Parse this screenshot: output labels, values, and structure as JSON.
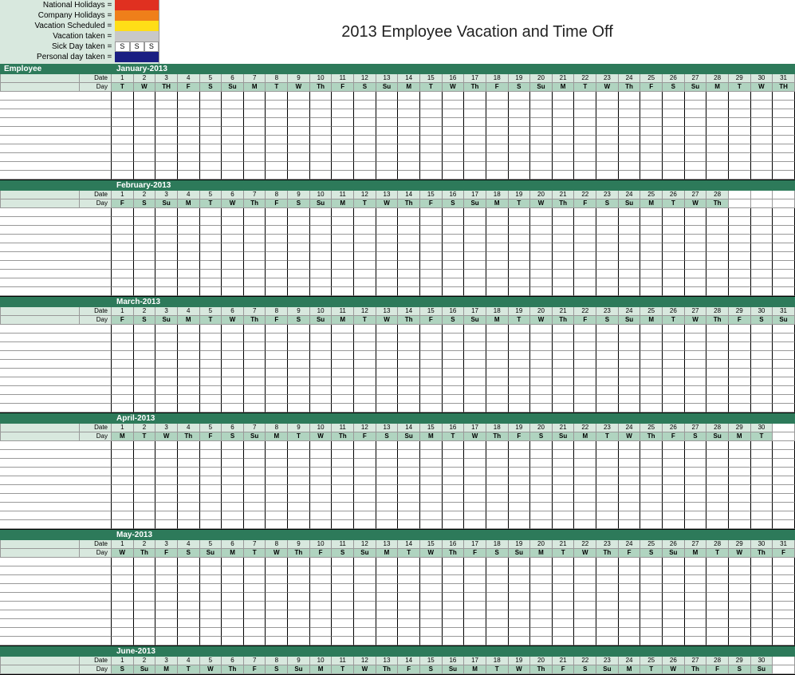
{
  "title": "2013 Employee Vacation and Time Off",
  "legend": {
    "national": "National Holidays =",
    "company": "Company Holidays =",
    "scheduled": "Vacation Scheduled =",
    "taken": "Vacation taken =",
    "sick": "Sick Day taken =",
    "personal": "Personal day taken =",
    "sick_marker": "S"
  },
  "employee_header": "Employee",
  "row_labels": {
    "date": "Date",
    "day": "Day"
  },
  "max_cols": 31,
  "emp_rows": 10,
  "months": [
    {
      "name": "January-2013",
      "days": 31,
      "dow": [
        "T",
        "W",
        "TH",
        "F",
        "S",
        "Su",
        "M",
        "T",
        "W",
        "Th",
        "F",
        "S",
        "Su",
        "M",
        "T",
        "W",
        "Th",
        "F",
        "S",
        "Su",
        "M",
        "T",
        "W",
        "Th",
        "F",
        "S",
        "Su",
        "M",
        "T",
        "W",
        "TH"
      ]
    },
    {
      "name": "February-2013",
      "days": 28,
      "dow": [
        "F",
        "S",
        "Su",
        "M",
        "T",
        "W",
        "Th",
        "F",
        "S",
        "Su",
        "M",
        "T",
        "W",
        "Th",
        "F",
        "S",
        "Su",
        "M",
        "T",
        "W",
        "Th",
        "F",
        "S",
        "Su",
        "M",
        "T",
        "W",
        "Th"
      ]
    },
    {
      "name": "March-2013",
      "days": 31,
      "dow": [
        "F",
        "S",
        "Su",
        "M",
        "T",
        "W",
        "Th",
        "F",
        "S",
        "Su",
        "M",
        "T",
        "W",
        "Th",
        "F",
        "S",
        "Su",
        "M",
        "T",
        "W",
        "Th",
        "F",
        "S",
        "Su",
        "M",
        "T",
        "W",
        "Th",
        "F",
        "S",
        "Su"
      ]
    },
    {
      "name": "April-2013",
      "days": 30,
      "dow": [
        "M",
        "T",
        "W",
        "Th",
        "F",
        "S",
        "Su",
        "M",
        "T",
        "W",
        "Th",
        "F",
        "S",
        "Su",
        "M",
        "T",
        "W",
        "Th",
        "F",
        "S",
        "Su",
        "M",
        "T",
        "W",
        "Th",
        "F",
        "S",
        "Su",
        "M",
        "T"
      ]
    },
    {
      "name": "May-2013",
      "days": 31,
      "dow": [
        "W",
        "Th",
        "F",
        "S",
        "Su",
        "M",
        "T",
        "W",
        "Th",
        "F",
        "S",
        "Su",
        "M",
        "T",
        "W",
        "Th",
        "F",
        "S",
        "Su",
        "M",
        "T",
        "W",
        "Th",
        "F",
        "S",
        "Su",
        "M",
        "T",
        "W",
        "Th",
        "F"
      ]
    },
    {
      "name": "June-2013",
      "days": 30,
      "dow": [
        "S",
        "Su",
        "M",
        "T",
        "W",
        "Th",
        "F",
        "S",
        "Su",
        "M",
        "T",
        "W",
        "Th",
        "F",
        "S",
        "Su",
        "M",
        "T",
        "W",
        "Th",
        "F",
        "S",
        "Su",
        "M",
        "T",
        "W",
        "Th",
        "F",
        "S",
        "Su"
      ]
    }
  ]
}
